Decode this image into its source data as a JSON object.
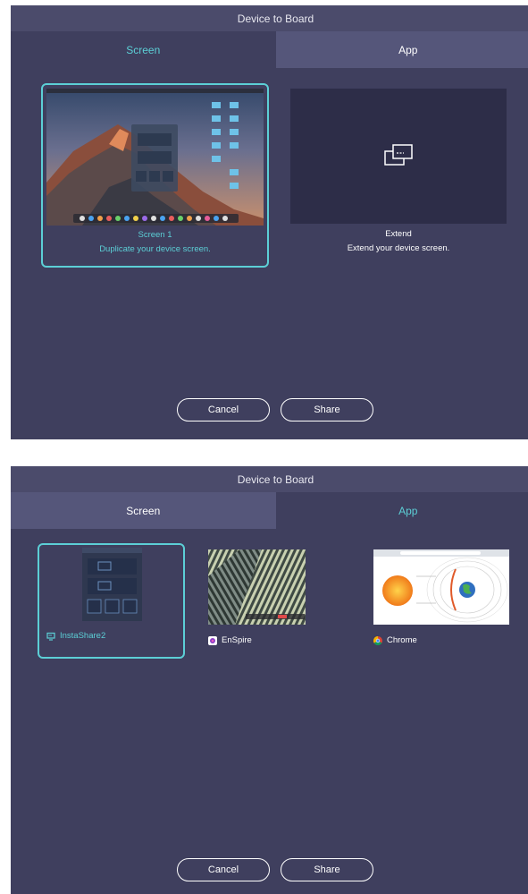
{
  "panel_top": {
    "title": "Device to Board",
    "tabs": [
      {
        "label": "Screen"
      },
      {
        "label": "App"
      }
    ],
    "screen1": {
      "name": "Screen 1",
      "desc": "Duplicate your device screen."
    },
    "extend": {
      "name": "Extend",
      "desc": "Extend your device screen."
    },
    "cancel_label": "Cancel",
    "share_label": "Share"
  },
  "panel_bottom": {
    "title": "Device to Board",
    "tabs": [
      {
        "label": "Screen"
      },
      {
        "label": "App"
      }
    ],
    "apps": [
      {
        "name": "InstaShare2"
      },
      {
        "name": "EnSpire"
      },
      {
        "name": "Chrome"
      }
    ],
    "cancel_label": "Cancel",
    "share_label": "Share"
  },
  "colors": {
    "accent": "#5ccfd6",
    "panel_bg": "#3f3f5e",
    "titlebar": "#4b4b6b",
    "inactive_tab": "#55567a"
  }
}
